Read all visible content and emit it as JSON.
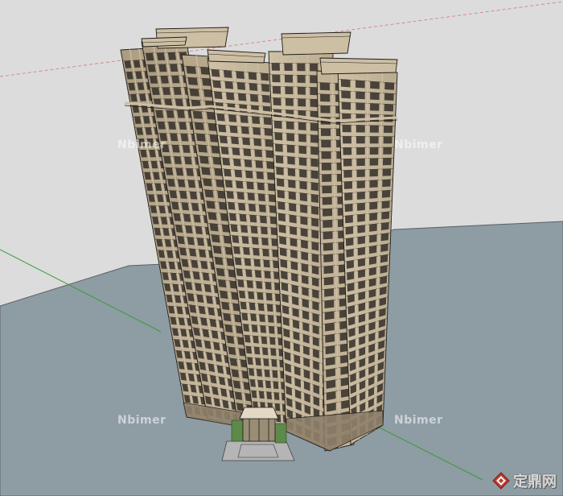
{
  "scene": {
    "subject": "high-rise-residential-tower-model",
    "colors": {
      "sky": "#dcdcdc",
      "ground": "#8e9ca4",
      "ground_edge": "#5a6066",
      "facade_light": "#cdbfa4",
      "facade_mid": "#b6a78b",
      "facade_dark": "#8e806a",
      "window": "#2e2a25",
      "outline": "#1f1c18",
      "axis_red": "#d88888",
      "axis_green": "#3b9b3b",
      "lobby_roof": "#e3d8c4",
      "planting": "#5d8a4a"
    }
  },
  "watermarks": [
    "Nbimer",
    "Nbimer",
    "Nbimer",
    "Nbimer"
  ],
  "logo": {
    "text": "定鼎网",
    "icon": "diamond-logo-icon",
    "color": "#c0392b"
  }
}
